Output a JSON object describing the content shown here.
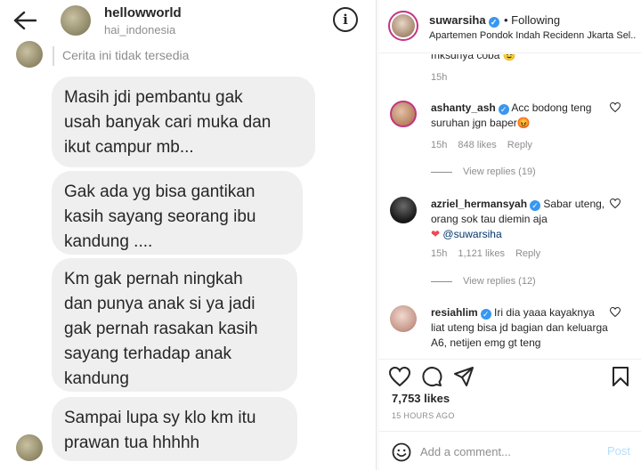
{
  "dm": {
    "username": "hellowworld",
    "subtitle": "hai_indonesia",
    "story_unavailable": "Cerita ini tidak tersedia",
    "messages": [
      "Masih jdi pembantu gak\nusah banyak cari muka dan\nikut campur mb...",
      "Gak ada yg bisa gantikan\nkasih sayang seorang ibu\nkandung ....",
      "Km gak pernah ningkah\ndan punya anak si ya jadi\ngak pernah rasakan kasih\nsayang terhadap anak\nkandung",
      "Sampai lupa sy klo km itu\nprawan tua hhhhh"
    ]
  },
  "post": {
    "username": "suwarsiha",
    "following": "• Following",
    "location": "Apartemen Pondok Indah Recidenn Jkarta Sel...",
    "prev_comment_text": "mksdnya coba 😉",
    "prev_comment_time": "15h",
    "comments": [
      {
        "user": "ashanty_ash",
        "text": "Acc bodong teng suruhan jgn baper😡",
        "time": "15h",
        "likes": "848 likes",
        "reply": "Reply",
        "view_replies": "View replies (19)"
      },
      {
        "user": "azriel_hermansyah",
        "text": "Sabar uteng, orang sok tau diemin aja",
        "mention": "@suwarsiha",
        "heart": "❤",
        "time": "15h",
        "likes": "1,121 likes",
        "reply": "Reply",
        "view_replies": "View replies (12)"
      },
      {
        "user": "resiahlim",
        "text": "Iri dia yaaa kayaknya liat uteng bisa jd bagian dan keluarga A6, netijen emg gt teng"
      }
    ],
    "likes_count": "7,753 likes",
    "time_ago": "15 HOURS AGO",
    "comment_placeholder": "Add a comment...",
    "post_button": "Post"
  },
  "colors": {
    "verified_blue": "#3897f0",
    "post_button_disabled": "#b2dffc",
    "bubble_gray": "#efefef",
    "heart_red": "#ed4956"
  }
}
